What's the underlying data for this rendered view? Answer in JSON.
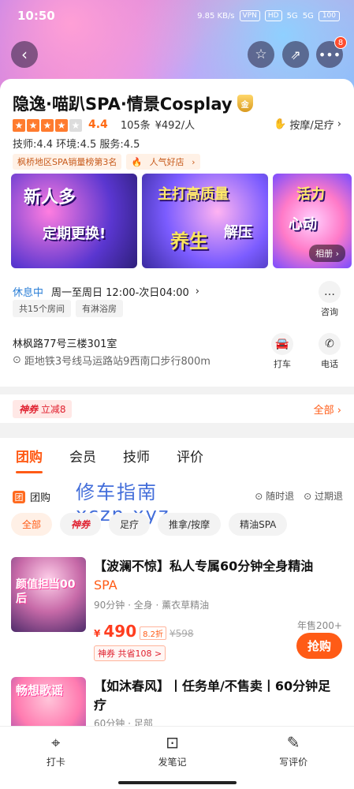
{
  "status_bar": {
    "time": "10:50",
    "speed": "9.85 KB/s",
    "vpn": "VPN",
    "hd": "HD",
    "signal1": "5G",
    "signal2": "5G",
    "battery": "100"
  },
  "nav": {
    "notification_count": "8"
  },
  "shop": {
    "name": "隐逸·喵趴SPA·情景Cosplay",
    "badge": "金",
    "rating": "4.4",
    "reviews": "105条",
    "price_per_person": "¥492/人",
    "category": "按摩/足疗",
    "scores": "技师:4.4  环境:4.5  服务:4.5",
    "rank_tags": [
      "枫桥地区SPA销量榜第3名",
      "人气好店"
    ],
    "stars": {
      "filled": 4,
      "total": 5
    }
  },
  "gallery": {
    "images": [
      {
        "text1": "新人多",
        "text2": "定期更换!"
      },
      {
        "text1": "主打高质量",
        "text2": "养生",
        "text3": "解压"
      },
      {
        "text1": "活力",
        "text2": "心动"
      }
    ],
    "album_label": "相册"
  },
  "hours": {
    "status": "休息中",
    "time": "周一至周日 12:00-次日04:00",
    "consult_label": "咨询"
  },
  "facility_tags": [
    "共15个房间",
    "有淋浴房"
  ],
  "address": {
    "line": "林枫路77号三楼301室",
    "distance": "距地铁3号线马运路站9西南口步行800m",
    "taxi_label": "打车",
    "phone_label": "电话"
  },
  "promo": {
    "tag": "神券",
    "text": "立减8",
    "all_label": "全部"
  },
  "tabs": [
    "团购",
    "会员",
    "技师",
    "评价"
  ],
  "group": {
    "label": "团购",
    "watermark_line1": "修车指南",
    "watermark_line2": "xczn.xyz",
    "policy": [
      "随时退",
      "过期退"
    ],
    "filters": [
      "全部",
      "神券",
      "足疗",
      "推拿/按摩",
      "精油SPA"
    ]
  },
  "deals": [
    {
      "title": "【波澜不惊】私人专属60分钟全身精油",
      "title_suffix": "SPA",
      "sub": "90分钟 · 全身 · 薰衣草精油",
      "currency": "¥",
      "price": "490",
      "discount": "8.2折",
      "original": "¥598",
      "save": "神券 共省108 >",
      "sold": "年售200+",
      "buy_label": "抢购",
      "thumb_text": "颜值担当00后"
    },
    {
      "title": "【如沐春风】丨任务单/不售卖丨60分钟足疗",
      "sub": "60分钟 · 足部",
      "thumb_text": "畅想歌谣"
    }
  ],
  "bottom_bar": [
    "打卡",
    "发笔记",
    "写评价"
  ]
}
